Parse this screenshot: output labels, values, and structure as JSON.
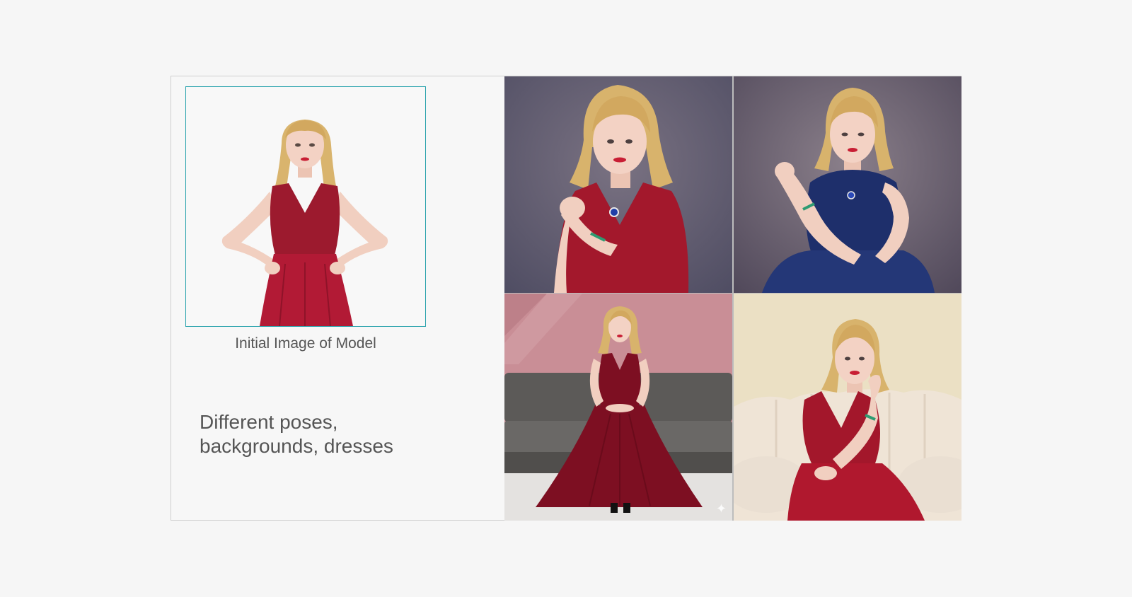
{
  "initial": {
    "caption": "Initial Image of Model"
  },
  "description": "Different poses,\nbackgrounds, dresses",
  "photos": [
    {
      "name": "photo-red-dress-purple-background",
      "background": "#5e5a6e",
      "dress": "#a3182c"
    },
    {
      "name": "photo-navy-dress-purple-background",
      "background": "#6f6471",
      "dress": "#1e2f6b"
    },
    {
      "name": "photo-red-dress-gray-sofa",
      "background": "#c98e96",
      "dress": "#7d0f22"
    },
    {
      "name": "photo-red-dress-cream-sofa",
      "background": "#ebe0c4",
      "dress": "#b0182e"
    }
  ],
  "colors": {
    "frame_accent": "#2aa3ad",
    "hair": "#d9b46d",
    "skin": "#f1cfc0"
  }
}
